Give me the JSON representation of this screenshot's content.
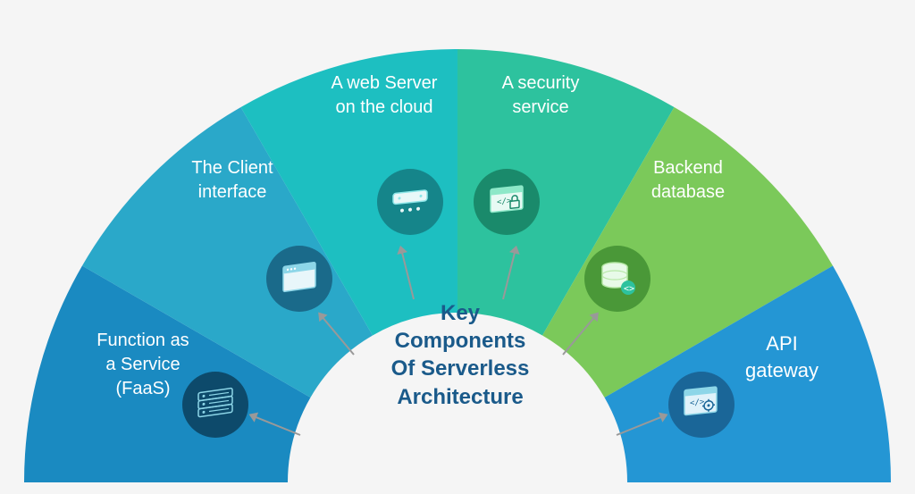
{
  "title": "Key\nComponents\nOf Serverless\nArchitecture",
  "segments": [
    {
      "label": "Function as\na Service\n(FaaS)",
      "color": "#1a8ac1",
      "iconBg": "#0d4a6b",
      "icon": "server"
    },
    {
      "label": "The Client\ninterface",
      "color": "#2aa8c9",
      "iconBg": "#1a6a8a",
      "icon": "window"
    },
    {
      "label": "A web Server\non the cloud",
      "color": "#1dbfc1",
      "iconBg": "#15858a",
      "icon": "router"
    },
    {
      "label": "A security\nservice",
      "color": "#2dc29e",
      "iconBg": "#1a8a6b",
      "icon": "lock-code"
    },
    {
      "label": "Backend\ndatabase",
      "color": "#7bc95a",
      "iconBg": "#4a9838",
      "icon": "database"
    },
    {
      "label": "API\ngateway",
      "color": "#2496d4",
      "iconBg": "#1a6698",
      "icon": "code-gear"
    }
  ]
}
